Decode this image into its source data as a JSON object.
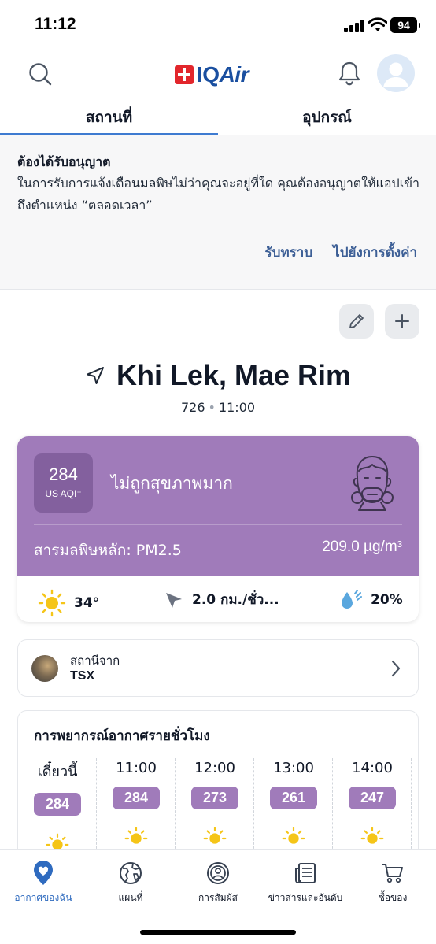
{
  "status_bar": {
    "time": "11:12",
    "battery": "94"
  },
  "header": {
    "logo_text_iq": "IQ",
    "logo_text_air": "Air"
  },
  "tabs": [
    {
      "label": "สถานที่",
      "active": true
    },
    {
      "label": "อุปกรณ์",
      "active": false
    }
  ],
  "permission_banner": {
    "title": "ต้องได้รับอนุญาต",
    "body": "ในการรับการแจ้งเตือนมลพิษไม่ว่าคุณจะอยู่ที่ใด คุณต้องอนุญาตให้แอปเข้าถึงตำแหน่ง “ตลอดเวลา”",
    "acknowledge_label": "รับทราบ",
    "settings_label": "ไปยังการตั้งค่า"
  },
  "location": {
    "name": "Khi Lek, Mae Rim",
    "elevation": "726",
    "time": "11:00"
  },
  "aqi": {
    "value": "284",
    "unit": "US AQI⁺",
    "status": "ไม่ถูกสุขภาพมาก",
    "color": "#a07bba",
    "main_pollutant": "สารมลพิษหลัก: PM2.5",
    "concentration": "209.0 µg/m³"
  },
  "weather": {
    "temperature": "34°",
    "wind": "2.0 กม./ชั่ว...",
    "humidity": "20%"
  },
  "station": {
    "label": "สถานีจาก",
    "name": "TSX"
  },
  "forecast": {
    "title": "การพยากรณ์อากาศรายชั่วโมง",
    "hours": [
      {
        "time": "เดี๋ยวนี้",
        "aqi": "284"
      },
      {
        "time": "11:00",
        "aqi": "284"
      },
      {
        "time": "12:00",
        "aqi": "273"
      },
      {
        "time": "13:00",
        "aqi": "261"
      },
      {
        "time": "14:00",
        "aqi": "247"
      }
    ]
  },
  "bottom_nav": [
    {
      "label": "อากาศของฉัน",
      "icon": "heart-pin-icon",
      "active": true
    },
    {
      "label": "แผนที่",
      "icon": "globe-icon",
      "active": false
    },
    {
      "label": "การสัมผัส",
      "icon": "exposure-icon",
      "active": false
    },
    {
      "label": "ข่าวสารและอันดับ",
      "icon": "news-icon",
      "active": false
    },
    {
      "label": "ซื้อของ",
      "icon": "cart-icon",
      "active": false
    }
  ]
}
